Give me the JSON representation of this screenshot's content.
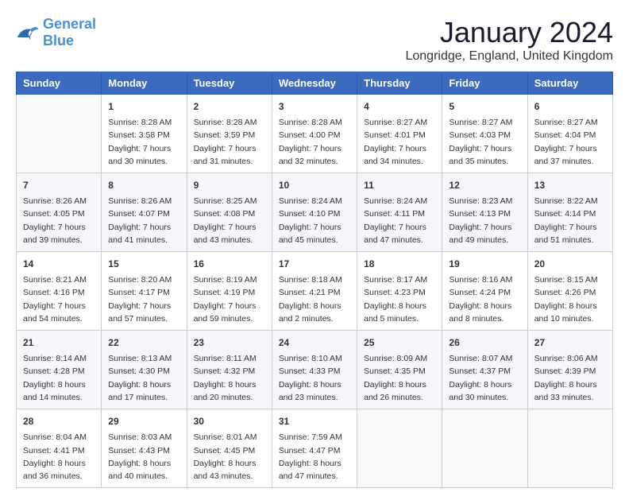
{
  "logo": {
    "text1": "General",
    "text2": "Blue"
  },
  "title": "January 2024",
  "location": "Longridge, England, United Kingdom",
  "days_of_week": [
    "Sunday",
    "Monday",
    "Tuesday",
    "Wednesday",
    "Thursday",
    "Friday",
    "Saturday"
  ],
  "weeks": [
    [
      {
        "day": "",
        "info": ""
      },
      {
        "day": "1",
        "info": "Sunrise: 8:28 AM\nSunset: 3:58 PM\nDaylight: 7 hours\nand 30 minutes."
      },
      {
        "day": "2",
        "info": "Sunrise: 8:28 AM\nSunset: 3:59 PM\nDaylight: 7 hours\nand 31 minutes."
      },
      {
        "day": "3",
        "info": "Sunrise: 8:28 AM\nSunset: 4:00 PM\nDaylight: 7 hours\nand 32 minutes."
      },
      {
        "day": "4",
        "info": "Sunrise: 8:27 AM\nSunset: 4:01 PM\nDaylight: 7 hours\nand 34 minutes."
      },
      {
        "day": "5",
        "info": "Sunrise: 8:27 AM\nSunset: 4:03 PM\nDaylight: 7 hours\nand 35 minutes."
      },
      {
        "day": "6",
        "info": "Sunrise: 8:27 AM\nSunset: 4:04 PM\nDaylight: 7 hours\nand 37 minutes."
      }
    ],
    [
      {
        "day": "7",
        "info": "Sunrise: 8:26 AM\nSunset: 4:05 PM\nDaylight: 7 hours\nand 39 minutes."
      },
      {
        "day": "8",
        "info": "Sunrise: 8:26 AM\nSunset: 4:07 PM\nDaylight: 7 hours\nand 41 minutes."
      },
      {
        "day": "9",
        "info": "Sunrise: 8:25 AM\nSunset: 4:08 PM\nDaylight: 7 hours\nand 43 minutes."
      },
      {
        "day": "10",
        "info": "Sunrise: 8:24 AM\nSunset: 4:10 PM\nDaylight: 7 hours\nand 45 minutes."
      },
      {
        "day": "11",
        "info": "Sunrise: 8:24 AM\nSunset: 4:11 PM\nDaylight: 7 hours\nand 47 minutes."
      },
      {
        "day": "12",
        "info": "Sunrise: 8:23 AM\nSunset: 4:13 PM\nDaylight: 7 hours\nand 49 minutes."
      },
      {
        "day": "13",
        "info": "Sunrise: 8:22 AM\nSunset: 4:14 PM\nDaylight: 7 hours\nand 51 minutes."
      }
    ],
    [
      {
        "day": "14",
        "info": "Sunrise: 8:21 AM\nSunset: 4:16 PM\nDaylight: 7 hours\nand 54 minutes."
      },
      {
        "day": "15",
        "info": "Sunrise: 8:20 AM\nSunset: 4:17 PM\nDaylight: 7 hours\nand 57 minutes."
      },
      {
        "day": "16",
        "info": "Sunrise: 8:19 AM\nSunset: 4:19 PM\nDaylight: 7 hours\nand 59 minutes."
      },
      {
        "day": "17",
        "info": "Sunrise: 8:18 AM\nSunset: 4:21 PM\nDaylight: 8 hours\nand 2 minutes."
      },
      {
        "day": "18",
        "info": "Sunrise: 8:17 AM\nSunset: 4:23 PM\nDaylight: 8 hours\nand 5 minutes."
      },
      {
        "day": "19",
        "info": "Sunrise: 8:16 AM\nSunset: 4:24 PM\nDaylight: 8 hours\nand 8 minutes."
      },
      {
        "day": "20",
        "info": "Sunrise: 8:15 AM\nSunset: 4:26 PM\nDaylight: 8 hours\nand 10 minutes."
      }
    ],
    [
      {
        "day": "21",
        "info": "Sunrise: 8:14 AM\nSunset: 4:28 PM\nDaylight: 8 hours\nand 14 minutes."
      },
      {
        "day": "22",
        "info": "Sunrise: 8:13 AM\nSunset: 4:30 PM\nDaylight: 8 hours\nand 17 minutes."
      },
      {
        "day": "23",
        "info": "Sunrise: 8:11 AM\nSunset: 4:32 PM\nDaylight: 8 hours\nand 20 minutes."
      },
      {
        "day": "24",
        "info": "Sunrise: 8:10 AM\nSunset: 4:33 PM\nDaylight: 8 hours\nand 23 minutes."
      },
      {
        "day": "25",
        "info": "Sunrise: 8:09 AM\nSunset: 4:35 PM\nDaylight: 8 hours\nand 26 minutes."
      },
      {
        "day": "26",
        "info": "Sunrise: 8:07 AM\nSunset: 4:37 PM\nDaylight: 8 hours\nand 30 minutes."
      },
      {
        "day": "27",
        "info": "Sunrise: 8:06 AM\nSunset: 4:39 PM\nDaylight: 8 hours\nand 33 minutes."
      }
    ],
    [
      {
        "day": "28",
        "info": "Sunrise: 8:04 AM\nSunset: 4:41 PM\nDaylight: 8 hours\nand 36 minutes."
      },
      {
        "day": "29",
        "info": "Sunrise: 8:03 AM\nSunset: 4:43 PM\nDaylight: 8 hours\nand 40 minutes."
      },
      {
        "day": "30",
        "info": "Sunrise: 8:01 AM\nSunset: 4:45 PM\nDaylight: 8 hours\nand 43 minutes."
      },
      {
        "day": "31",
        "info": "Sunrise: 7:59 AM\nSunset: 4:47 PM\nDaylight: 8 hours\nand 47 minutes."
      },
      {
        "day": "",
        "info": ""
      },
      {
        "day": "",
        "info": ""
      },
      {
        "day": "",
        "info": ""
      }
    ]
  ]
}
